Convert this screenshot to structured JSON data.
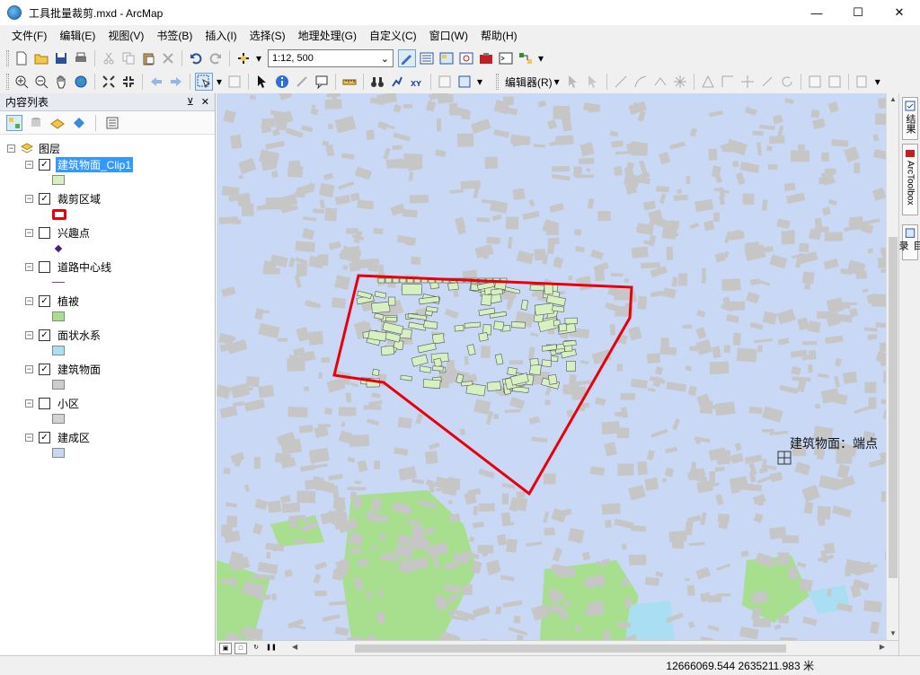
{
  "window": {
    "title": "工具批量裁剪.mxd - ArcMap"
  },
  "menu": [
    "文件(F)",
    "编辑(E)",
    "视图(V)",
    "书签(B)",
    "插入(I)",
    "选择(S)",
    "地理处理(G)",
    "自定义(C)",
    "窗口(W)",
    "帮助(H)"
  ],
  "toolbar": {
    "scale": "1:12, 500",
    "editor_label": "编辑器(R)"
  },
  "toc": {
    "title": "内容列表",
    "root_label": "图层",
    "layers": [
      {
        "name": "建筑物面_Clip1",
        "checked": true,
        "selected": true,
        "swatch": "#d6f0c2",
        "swatch_kind": "fill"
      },
      {
        "name": "裁剪区域",
        "checked": true,
        "selected": false,
        "swatch": "#e8000b",
        "swatch_kind": "outline"
      },
      {
        "name": "兴趣点",
        "checked": false,
        "selected": false,
        "swatch": "#4b1d86",
        "swatch_kind": "point"
      },
      {
        "name": "道路中心线",
        "checked": false,
        "selected": false,
        "swatch": "#8c3a9c",
        "swatch_kind": "line"
      },
      {
        "name": "植被",
        "checked": true,
        "selected": false,
        "swatch": "#a8df8f",
        "swatch_kind": "fill"
      },
      {
        "name": "面状水系",
        "checked": true,
        "selected": false,
        "swatch": "#a9def3",
        "swatch_kind": "fill"
      },
      {
        "name": "建筑物面",
        "checked": true,
        "selected": false,
        "swatch": "#cccccc",
        "swatch_kind": "fill"
      },
      {
        "name": "小区",
        "checked": false,
        "selected": false,
        "swatch": "#d3d3d3",
        "swatch_kind": "fill"
      },
      {
        "name": "建成区",
        "checked": true,
        "selected": false,
        "swatch": "#c8d8f3",
        "swatch_kind": "fill"
      }
    ]
  },
  "map": {
    "label": "建筑物面：端点",
    "colors": {
      "background": "#c9d8f5",
      "building": "#c6c6c6",
      "clip_building": "#d6f0c2",
      "clip_outline": "#e8000b",
      "vegetation": "#a8df8f",
      "water": "#a9def3"
    }
  },
  "right_dock": {
    "tabs": [
      "结果",
      "ArcToolbox",
      "目录"
    ]
  },
  "status": {
    "coordinates": "12666069.544  2635211.983 米"
  }
}
